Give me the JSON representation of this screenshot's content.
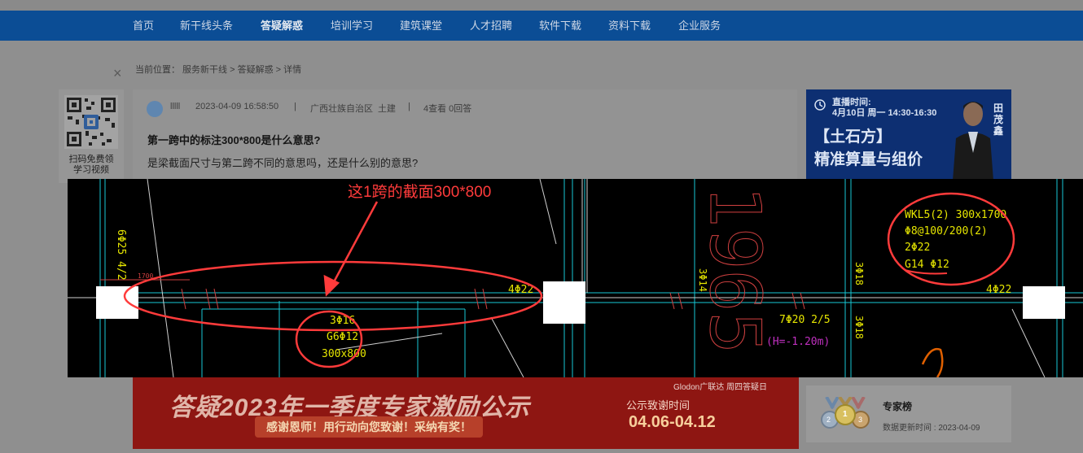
{
  "nav": {
    "items": [
      {
        "label": "首页"
      },
      {
        "label": "新干线头条"
      },
      {
        "label": "答疑解惑"
      },
      {
        "label": "培训学习"
      },
      {
        "label": "建筑课堂"
      },
      {
        "label": "人才招聘"
      },
      {
        "label": "软件下载"
      },
      {
        "label": "资料下载"
      },
      {
        "label": "企业服务"
      }
    ],
    "active_index": 2
  },
  "breadcrumb": "当前位置：  服务新干线 > 答疑解惑 > 详情",
  "close_icon": "×",
  "qr": {
    "caption_line1": "扫码免费领",
    "caption_line2": "学习视频"
  },
  "question": {
    "user": "lllll",
    "datetime": "2023-04-09 16:58:50",
    "separator": "|",
    "region": "广西壮族自治区",
    "category": "土建",
    "stats": "4查看   0回答",
    "title": "第一跨中的标注300*800是什么意思?",
    "body": "是梁截面尺寸与第二跨不同的意思吗，还是什么别的意思?"
  },
  "live": {
    "time_line1": "直播时间:",
    "time_line2": "4月10日 周一 14:30-16:30",
    "title_line1": "【土石方】",
    "title_line2": "精准算量与组价",
    "presenter": "田茂鑫"
  },
  "cad": {
    "annotation": "这1跨的截面300*800",
    "left_rebar": "4Φ22",
    "right_rebar": "4Φ22",
    "span_lines": [
      "3Φ16",
      "G6Φ12",
      "300x800"
    ],
    "beam_lines": [
      "WKL5(2) 300x1700",
      "Φ8@100/200(2)",
      "2Φ22",
      "G14 Φ12"
    ],
    "bottom_rebar": "7Φ20 2/5",
    "elevation": "(H=-1.20m)",
    "big_number": "1965",
    "vertical_left": "6Φ25 4/2",
    "vertical_mid": "3Φ14",
    "vertical_right1": "3Φ18",
    "vertical_right2": "3Φ18",
    "small_dim": "1700"
  },
  "banner": {
    "logo": "Glodon广联达  周四答疑日",
    "title": "答疑2023年一季度专家激励公示",
    "subtitle": "感谢恩师！用行动向您致谢！采纳有奖！",
    "label": "公示致谢时间",
    "dates": "04.06-04.12"
  },
  "expert": {
    "title": "专家榜",
    "updated": "数据更新时间 : 2023-04-09",
    "medal_ranks": [
      "2",
      "1",
      "3"
    ]
  },
  "colors": {
    "nav_bg": "#0b4d95",
    "cad_bg": "#000000",
    "annotation_red": "#ff3b3b",
    "cad_yellow": "#e6e600",
    "cad_cyan": "#17c9d6",
    "banner_red": "#8e1612"
  }
}
